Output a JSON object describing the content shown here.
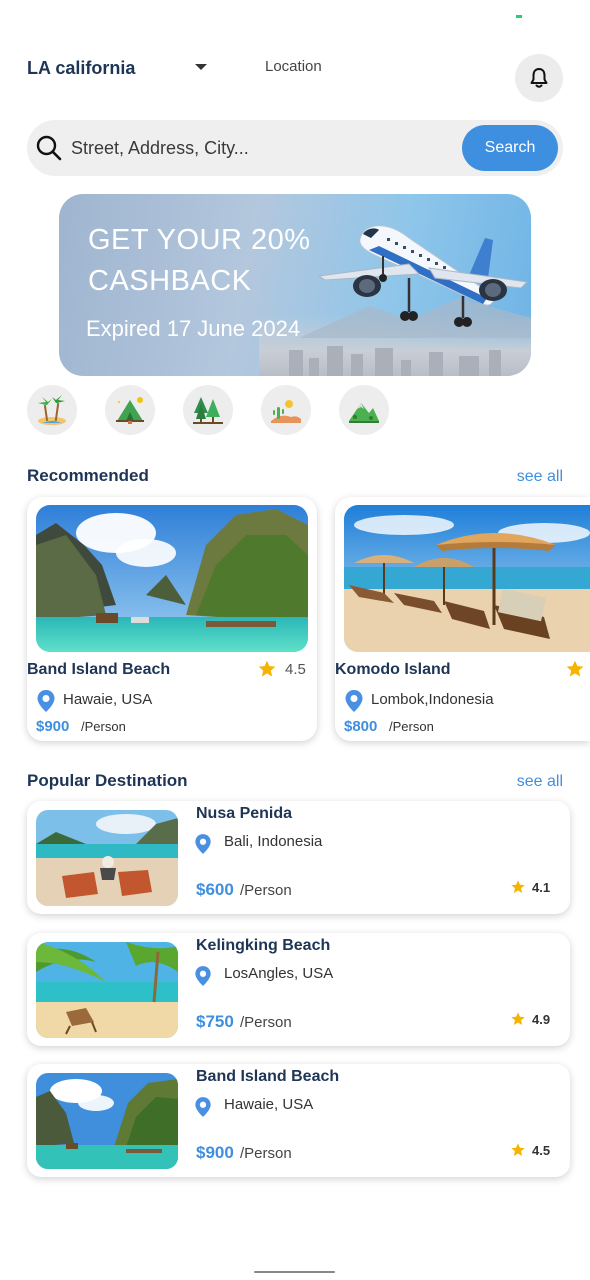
{
  "header": {
    "location_name": "LA california",
    "location_label": "Location"
  },
  "search": {
    "placeholder": "Street, Address, City...",
    "button_label": "Search"
  },
  "promo": {
    "title": "GET YOUR 20% CASHBACK",
    "expiry": "Expired 17 June 2024"
  },
  "categories": [
    {
      "icon": "beach-palm-icon"
    },
    {
      "icon": "camping-tent-icon"
    },
    {
      "icon": "forest-icon"
    },
    {
      "icon": "desert-icon"
    },
    {
      "icon": "mountain-icon"
    }
  ],
  "recommended": {
    "title": "Recommended",
    "see_all": "see all",
    "items": [
      {
        "name": "Band Island Beach",
        "rating": "4.5",
        "location": "Hawaie, USA",
        "price": "$900",
        "per": "/Person"
      },
      {
        "name": "Komodo Island",
        "rating": "",
        "location": "Lombok,Indonesia",
        "price": "$800",
        "per": "/Person"
      }
    ]
  },
  "popular": {
    "title": "Popular Destination",
    "see_all": "see all",
    "items": [
      {
        "name": "Nusa Penida",
        "location": "Bali, Indonesia",
        "price": "$600",
        "per": "/Person",
        "rating": "4.1"
      },
      {
        "name": "Kelingking Beach",
        "location": "LosAngles, USA",
        "price": "$750",
        "per": "/Person",
        "rating": "4.9"
      },
      {
        "name": "Band Island Beach",
        "location": "Hawaie, USA",
        "price": "$900",
        "per": "/Person",
        "rating": "4.5"
      }
    ]
  },
  "colors": {
    "accent": "#3f8fe0",
    "heading": "#1e3556",
    "star": "#f5b400"
  }
}
